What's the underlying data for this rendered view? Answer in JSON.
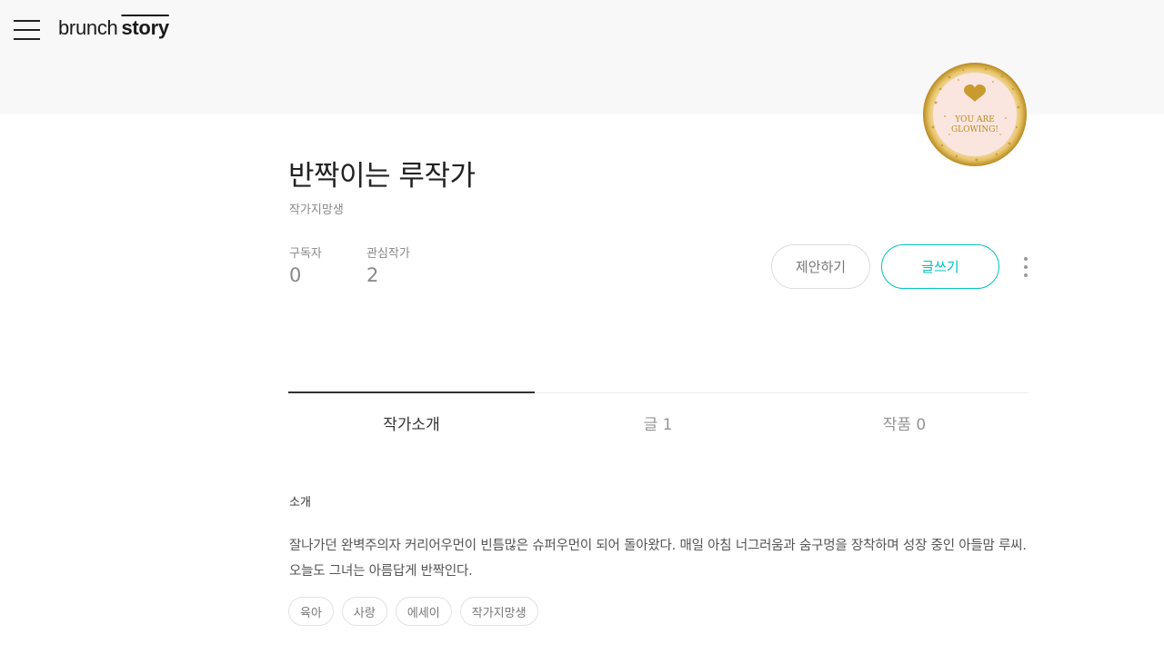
{
  "header": {
    "logo_part1": "brunch",
    "logo_part2": "story"
  },
  "profile": {
    "name": "반짝이는 루작가",
    "tagline": "작가지망생",
    "avatar_text_line1": "YOU ARE",
    "avatar_text_line2": "GLOWING!",
    "stats": {
      "subscribers_label": "구독자",
      "subscribers_value": "0",
      "following_label": "관심작가",
      "following_value": "2"
    },
    "actions": {
      "propose_label": "제안하기",
      "write_label": "글쓰기"
    }
  },
  "tabs": [
    {
      "label": "작가소개",
      "active": true
    },
    {
      "label": "글 1",
      "active": false
    },
    {
      "label": "작품 0",
      "active": false
    }
  ],
  "intro": {
    "section_title": "소개",
    "text": "잘나가던 완벽주의자 커리어우먼이 빈틈많은 슈퍼우먼이 되어 돌아왔다. 매일 아침 너그러움과 숨구멍을 장착하며 성장 중인 아들맘 루씨. 오늘도 그녀는 아름답게 반짝인다.",
    "tags": [
      "육아",
      "사랑",
      "에세이",
      "작가지망생"
    ]
  },
  "colors": {
    "accent": "#00c3bd",
    "header_bg": "#f8f8f8",
    "avatar_bg": "#fbe6df",
    "avatar_gold": "#c9a13a"
  },
  "icons": {
    "menu": "hamburger-menu-icon",
    "more": "more-vertical-icon",
    "avatar_heart": "heart-icon"
  }
}
